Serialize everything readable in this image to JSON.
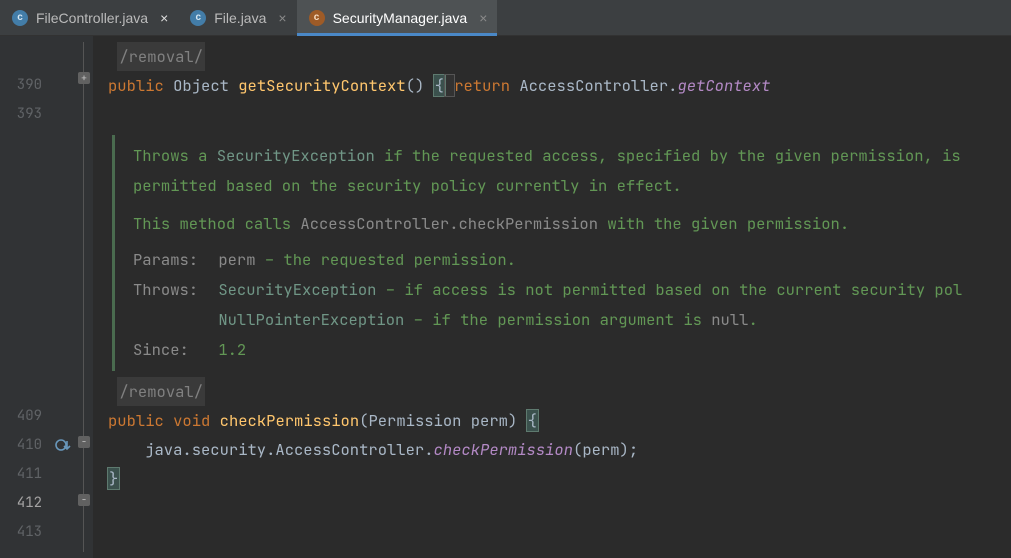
{
  "tabs": [
    {
      "name": "FileController.java",
      "icon": "c",
      "active": false,
      "iconColor": "blue"
    },
    {
      "name": "File.java",
      "icon": "c",
      "active": false,
      "iconColor": "blue"
    },
    {
      "name": "SecurityManager.java",
      "icon": "c",
      "active": true,
      "iconColor": "orange"
    }
  ],
  "gutter": {
    "lines": [
      "",
      "390",
      "393",
      "",
      "",
      "",
      "",
      "",
      "",
      "",
      "",
      "409",
      "410",
      "411",
      "412",
      "413"
    ]
  },
  "code": {
    "removal_annot": "/removal/",
    "line390": {
      "public": "public",
      "object": "Object",
      "method": "getSecurityContext",
      "parens": "()",
      "brace": "{",
      "return": "return",
      "controller": "AccessController.",
      "getcontext": "getContext"
    },
    "doc": {
      "p1a": "Throws a ",
      "p1_link": "SecurityException",
      "p1b": " if the requested access, specified by the given permission, is",
      "p2": "permitted based on the security policy currently in effect.",
      "p3a": "This method calls ",
      "p3_code": "AccessController.checkPermission",
      "p3b": " with the given permission.",
      "params_label": "Params:",
      "params_code": "perm",
      "params_text": " – the requested permission.",
      "throws_label": "Throws:",
      "throws1_link": "SecurityException",
      "throws1_text": " – if access is not permitted based on the current security pol",
      "throws2_link": "NullPointerException",
      "throws2_text": " – if the permission argument is ",
      "throws2_code": "null",
      "throws2_dot": ".",
      "since_label": "Since:",
      "since_val": "1.2"
    },
    "line410": {
      "public": "public",
      "void": "void",
      "method": "checkPermission",
      "sig_open": "(Permission perm) ",
      "brace": "{"
    },
    "line411": {
      "prefix": "java.security.AccessController.",
      "call": "checkPermission",
      "args": "(perm);"
    },
    "line412": {
      "brace": "}"
    }
  }
}
